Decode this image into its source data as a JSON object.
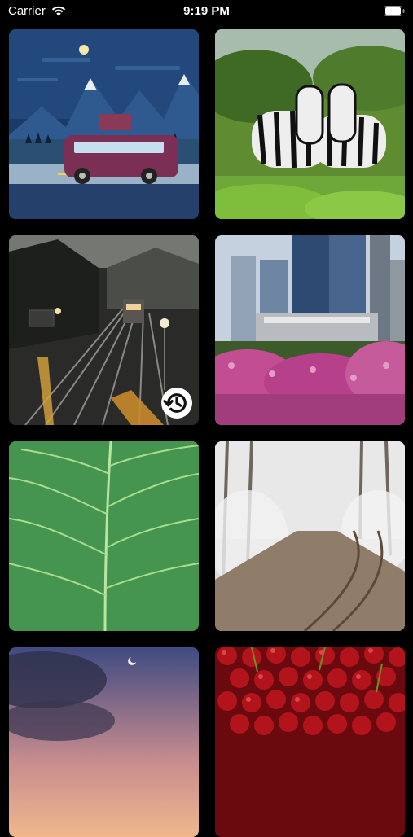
{
  "status_bar": {
    "carrier": "Carrier",
    "time": "9:19 PM"
  },
  "gallery": {
    "items": [
      {
        "name": "van-night-illustration",
        "colors": [
          "#1f3e6b",
          "#7a2e4e"
        ]
      },
      {
        "name": "zebras",
        "colors": [
          "#5e8f2a",
          "#2a2a2a"
        ]
      },
      {
        "name": "railway-night",
        "colors": [
          "#3c3c3a",
          "#d7a23a"
        ],
        "badge_icon": "history-icon"
      },
      {
        "name": "city-skyline-flowers",
        "colors": [
          "#6a7b93",
          "#b74d8d"
        ]
      },
      {
        "name": "green-leaf",
        "colors": [
          "#3e8d4a",
          "#89c66b"
        ]
      },
      {
        "name": "snowy-forest-track",
        "colors": [
          "#d8d8d8",
          "#6d5c4b"
        ]
      },
      {
        "name": "dusk-sky",
        "colors": [
          "#434a78",
          "#d59c8e"
        ]
      },
      {
        "name": "cherries",
        "colors": [
          "#a60f16",
          "#7f0c11"
        ]
      }
    ]
  }
}
